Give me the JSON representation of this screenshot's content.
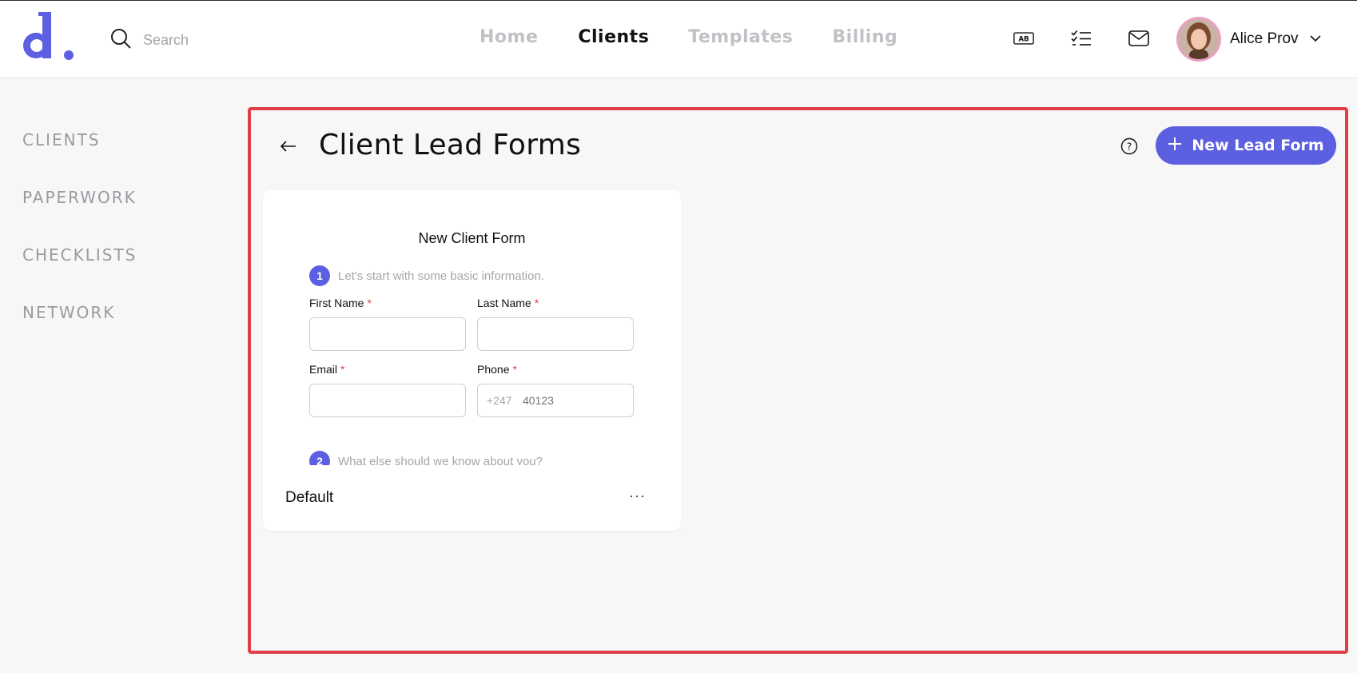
{
  "header": {
    "search_placeholder": "Search",
    "nav": [
      {
        "label": "Home",
        "active": false
      },
      {
        "label": "Clients",
        "active": true
      },
      {
        "label": "Templates",
        "active": false
      },
      {
        "label": "Billing",
        "active": false
      }
    ],
    "icons": [
      "ab-badge-icon",
      "checklist-icon",
      "mail-icon"
    ],
    "user_name": "Alice Prov"
  },
  "sidebar": {
    "items": [
      "CLIENTS",
      "PAPERWORK",
      "CHECKLISTS",
      "NETWORK"
    ]
  },
  "main": {
    "title": "Client Lead Forms",
    "new_button_label": "New Lead Form"
  },
  "form_card": {
    "preview_title": "New Client Form",
    "step1_num": "1",
    "step1_text": "Let's start with some basic information.",
    "first_name_label": "First Name",
    "last_name_label": "Last Name",
    "email_label": "Email",
    "phone_label": "Phone",
    "required_mark": "*",
    "phone_prefix": "+247",
    "phone_placeholder": "40123",
    "step2_num": "2",
    "step2_text": "What else should we know about you?",
    "name": "Default",
    "menu": "···"
  },
  "colors": {
    "accent": "#5b5fe0",
    "highlight_border": "#e04048",
    "required": "#e04048",
    "avatar_ring": "#e9a0c2"
  }
}
